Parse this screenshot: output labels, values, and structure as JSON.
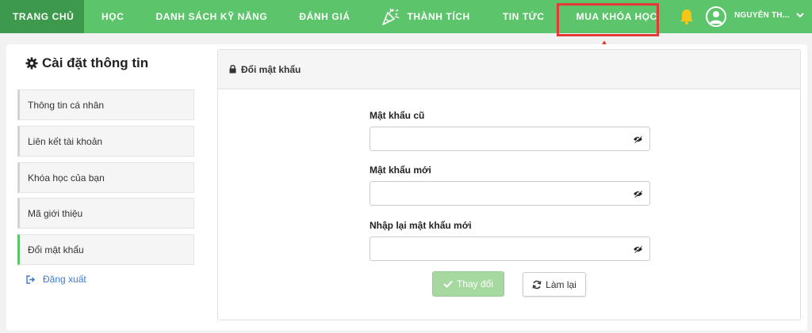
{
  "nav": {
    "items": [
      {
        "label": "TRANG CHỦ"
      },
      {
        "label": "HỌC"
      },
      {
        "label": "DANH SÁCH KỸ NĂNG"
      },
      {
        "label": "ĐÁNH GIÁ"
      },
      {
        "label": "THÀNH TÍCH"
      },
      {
        "label": "TIN TỨC"
      },
      {
        "label": "MUA KHÓA HỌC"
      }
    ],
    "user_name": "NGUYỄN TH...",
    "icons": {
      "trophy": "confetti-icon",
      "bell": "bell-icon",
      "avatar": "user-avatar-icon",
      "dropdown": "chevron-down-icon"
    },
    "colors": {
      "bar": "#5cc46b",
      "active": "#3d9a4c",
      "bell": "#f5c518",
      "highlight": "#e53935"
    }
  },
  "sidebar": {
    "title": "Cài đặt thông tin",
    "items": [
      {
        "label": "Thông tin cá nhân"
      },
      {
        "label": "Liên kết tài khoản"
      },
      {
        "label": "Khóa học của bạn"
      },
      {
        "label": "Mã giới thiệu"
      },
      {
        "label": "Đổi mật khẩu"
      }
    ],
    "active_item": "Đổi mật khẩu",
    "logout": "Đăng xuất"
  },
  "panel": {
    "title": "Đổi mật khẩu",
    "fields": [
      {
        "label": "Mật khẩu cũ",
        "value": "",
        "placeholder": ""
      },
      {
        "label": "Mật khẩu mới",
        "value": "",
        "placeholder": ""
      },
      {
        "label": "Nhập lại mật khẩu mới",
        "value": "",
        "placeholder": ""
      }
    ],
    "submit_label": "Thay đổi",
    "reset_label": "Làm lại"
  }
}
